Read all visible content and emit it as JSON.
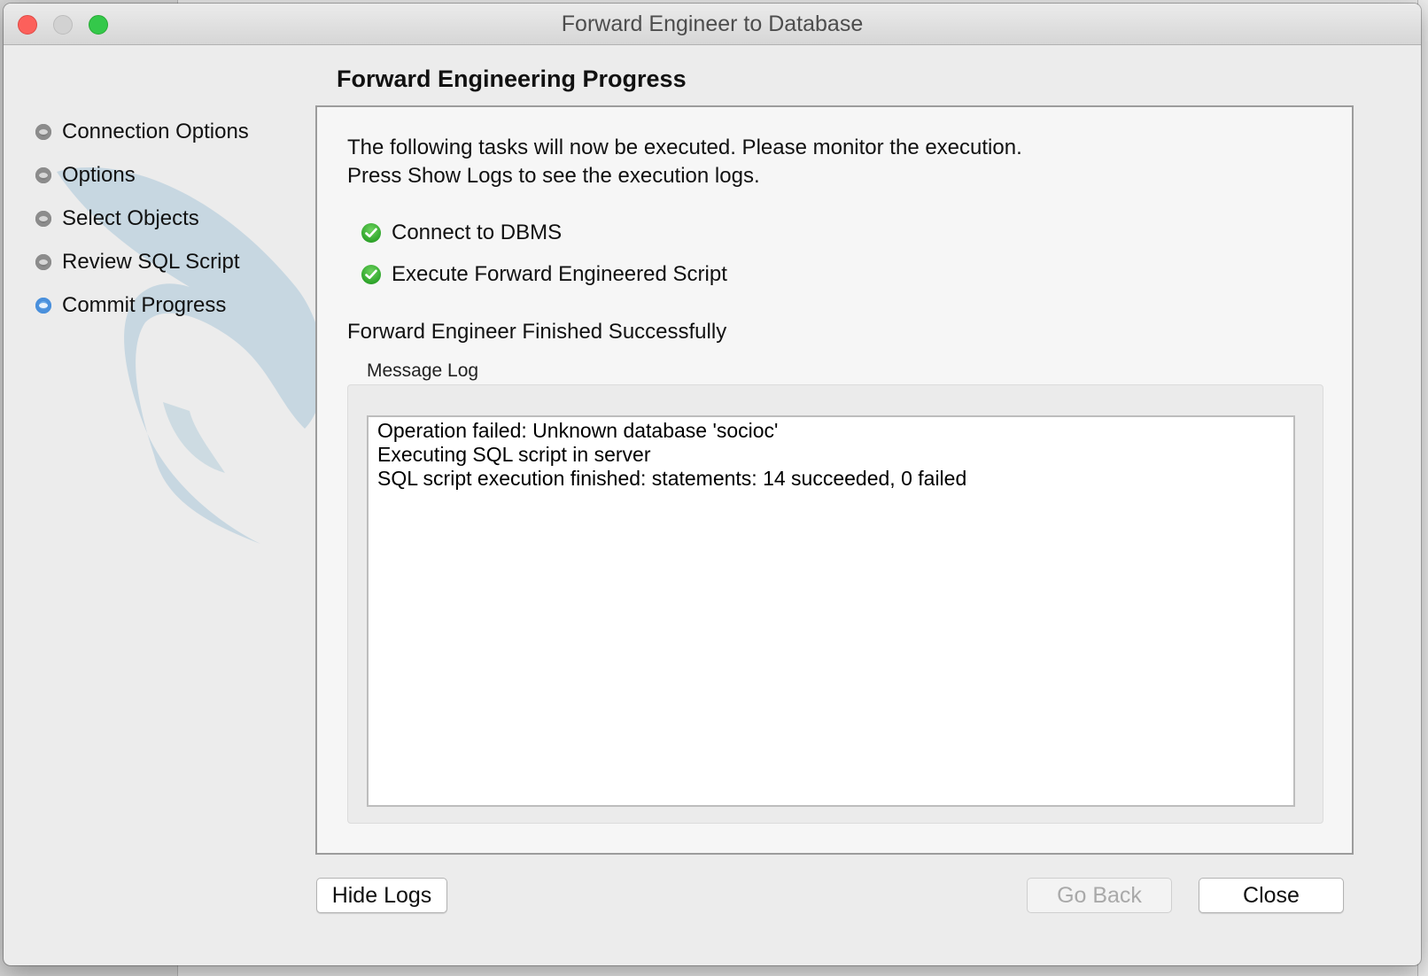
{
  "window": {
    "title": "Forward Engineer to Database"
  },
  "sidebar": {
    "steps": [
      {
        "label": "Connection Options",
        "state": "inactive"
      },
      {
        "label": "Options",
        "state": "inactive"
      },
      {
        "label": "Select Objects",
        "state": "inactive"
      },
      {
        "label": "Review SQL Script",
        "state": "inactive"
      },
      {
        "label": "Commit Progress",
        "state": "active"
      }
    ]
  },
  "main": {
    "title": "Forward Engineering Progress",
    "intro_line1": "The following tasks will now be executed. Please monitor the execution.",
    "intro_line2": "Press Show Logs to see the execution logs.",
    "tasks": [
      {
        "label": "Connect to DBMS",
        "status": "completed"
      },
      {
        "label": "Execute Forward Engineered Script",
        "status": "completed"
      }
    ],
    "status": "Forward Engineer Finished Successfully",
    "message_log": {
      "label": "Message Log",
      "lines": [
        "Operation failed: Unknown database 'socioc'",
        "Executing SQL script in server",
        "SQL script execution finished: statements: 14 succeeded, 0 failed"
      ]
    }
  },
  "buttons": {
    "hide_logs": "Hide Logs",
    "go_back": "Go Back",
    "close": "Close"
  },
  "icons": {
    "check": "check-circle-icon",
    "step_bullet": "step-bullet-icon"
  },
  "colors": {
    "active_step": "#3a84d6",
    "success": "#2fa52b",
    "close_light": "#fc605b",
    "zoom_light": "#34c84a"
  }
}
